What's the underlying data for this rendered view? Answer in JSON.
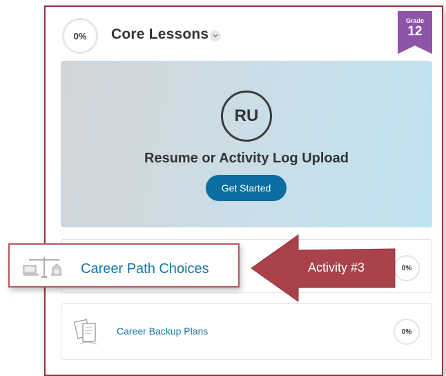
{
  "section": {
    "progress": "0%",
    "title": "Core Lessons",
    "grade_label": "Grade",
    "grade_number": "12"
  },
  "hero": {
    "icon_text": "RU",
    "title": "Resume or Activity Log Upload",
    "button_label": "Get Started"
  },
  "activities": [
    {
      "title": "Career Path Choices",
      "progress": "0%",
      "icon": "scales-icon"
    },
    {
      "title": "Career Backup Plans",
      "progress": "0%",
      "icon": "documents-icon"
    }
  ],
  "annotation": {
    "label": "Activity #3",
    "color": "#a9424b"
  },
  "colors": {
    "accent": "#0a6fa0",
    "link": "#1575a6",
    "ribbon": "#8e54a8",
    "frame": "#8c3a40"
  }
}
